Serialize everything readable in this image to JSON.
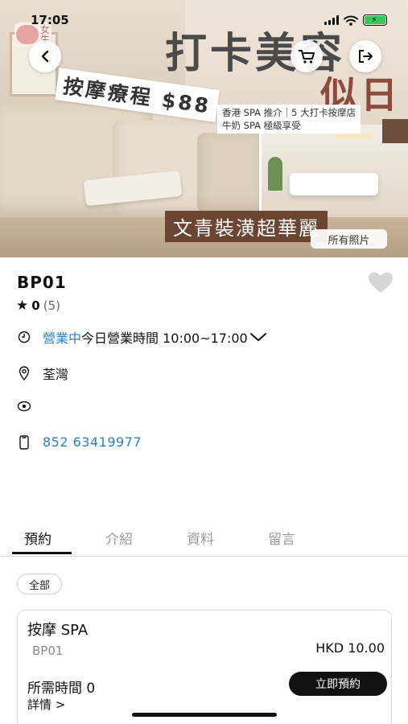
{
  "status_bar": {
    "time": "17:05"
  },
  "hero": {
    "logo_text": "女\n生",
    "big_title": "打卡美容",
    "sub_title": "似日",
    "tilt_label": "按摩療程 $88",
    "note_lines": [
      "香港 SPA 推介｜5 大打卡按摩店",
      "牛奶 SPA 極級享受"
    ],
    "banner": "文青裝潢超華麗",
    "all_photos": "所有照片"
  },
  "shop": {
    "name": "BP01",
    "rating_score": "0",
    "rating_count": "(5)",
    "open_status": "營業中",
    "hours": "今日營業時間 10:00~17:00",
    "location": "荃灣",
    "views": "",
    "phone": "852 63419977"
  },
  "tabs": [
    "預約",
    "介紹",
    "資料",
    "留言"
  ],
  "filter_chip": "全部",
  "service": {
    "name": "按摩 SPA",
    "code": "BP01",
    "price": "HKD 10.00",
    "duration": "所需時間 0",
    "book_label": "立即預約",
    "details_label": "詳情 >"
  },
  "icons": {
    "back": "chevron-left-icon",
    "cart": "cart-icon",
    "share": "share-icon",
    "favorite": "heart-icon",
    "star": "star-icon",
    "clock": "clock-icon",
    "location": "location-pin-icon",
    "eye": "eye-icon",
    "phone": "phone-icon"
  },
  "colors": {
    "link_blue": "#2f7fc8",
    "primary_button": "#111111",
    "heart_gray": "#d6d6d6",
    "battery_green": "#37c759"
  }
}
